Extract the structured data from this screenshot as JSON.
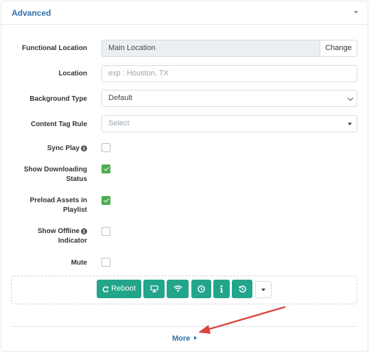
{
  "panel": {
    "title": "Advanced"
  },
  "fields": {
    "functional_location": {
      "label": "Functional Location",
      "value": "Main Location",
      "change_label": "Change"
    },
    "location": {
      "label": "Location",
      "placeholder": "exp : Houston, TX"
    },
    "background_type": {
      "label": "Background Type",
      "value": "Default"
    },
    "content_tag_rule": {
      "label": "Content Tag Rule",
      "placeholder": "Select"
    }
  },
  "checkboxes": {
    "sync_play": {
      "label": "Sync Play",
      "checked": false
    },
    "show_downloading_status": {
      "label_line1": "Show Downloading",
      "label_line2": "Status",
      "checked": true
    },
    "preload_assets": {
      "label_line1": "Preload Assets in",
      "label_line2": "Playlist",
      "checked": true
    },
    "show_offline_indicator": {
      "label_line1": "Show Offline",
      "label_line2": "Indicator",
      "checked": false
    },
    "mute": {
      "label": "Mute",
      "checked": false
    }
  },
  "actions": {
    "reboot_label": "Reboot",
    "button_color": "#22a58a",
    "buttons": [
      "reboot",
      "screen",
      "wifi",
      "clock",
      "info",
      "history"
    ]
  },
  "footer": {
    "more_label": "More"
  },
  "annotation": {
    "arrow_color": "#d9443a"
  }
}
